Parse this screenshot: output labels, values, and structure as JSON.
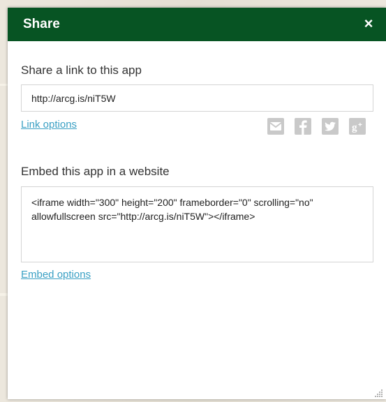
{
  "dialog": {
    "title": "Share",
    "close_label": "×"
  },
  "share_link": {
    "heading": "Share a link to this app",
    "url_value": "http://arcg.is/niT5W",
    "options_label": "Link options"
  },
  "social_icons": [
    {
      "name": "email-icon"
    },
    {
      "name": "facebook-icon"
    },
    {
      "name": "twitter-icon"
    },
    {
      "name": "google-plus-icon"
    }
  ],
  "embed": {
    "heading": "Embed this app in a website",
    "code": "<iframe width=\"300\" height=\"200\" frameborder=\"0\" scrolling=\"no\" allowfullscreen src=\"http://arcg.is/niT5W\"></iframe>",
    "options_label": "Embed options"
  },
  "colors": {
    "titlebar": "#075423",
    "link": "#3aa0c4",
    "icon": "#c9c9c9"
  }
}
